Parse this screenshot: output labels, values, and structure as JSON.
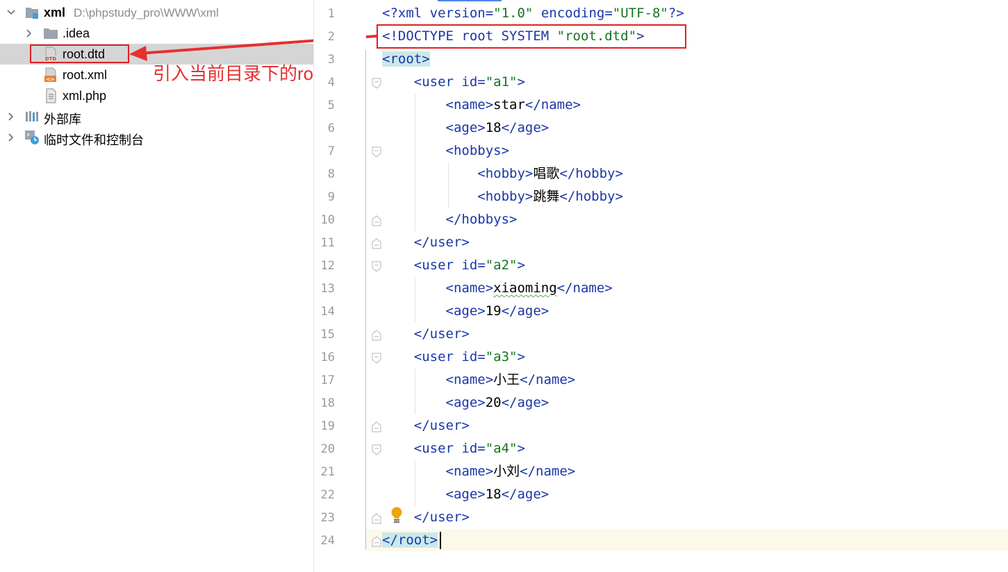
{
  "project_tree": {
    "root": {
      "name": "xml",
      "path": "D:\\phpstudy_pro\\WWW\\xml"
    },
    "items": [
      {
        "name": ".idea",
        "type": "folder",
        "expanded": false
      },
      {
        "name": "root.dtd",
        "type": "dtd-file",
        "selected": true
      },
      {
        "name": "root.xml",
        "type": "xml-file"
      },
      {
        "name": "xml.php",
        "type": "php-file"
      }
    ],
    "external_libraries": "外部库",
    "scratches": "临时文件和控制台"
  },
  "annotation": {
    "text": "引入当前目录下的root.dtd",
    "color": "#e53030"
  },
  "editor": {
    "line_numbers": [
      "1",
      "2",
      "3",
      "4",
      "5",
      "6",
      "7",
      "8",
      "9",
      "10",
      "11",
      "12",
      "13",
      "14",
      "15",
      "16",
      "17",
      "18",
      "19",
      "20",
      "21",
      "22",
      "23",
      "24"
    ],
    "l1": {
      "open": "<?",
      "kw": "xml",
      "a1": " version=",
      "v1": "\"1.0\"",
      "a2": " encoding=",
      "v2": "\"UTF-8\"",
      "close": "?>"
    },
    "l2": {
      "open": "<!DOCTYPE root SYSTEM ",
      "v": "\"root.dtd\"",
      "close": ">"
    },
    "l3": {
      "tag": "<root>"
    },
    "users": [
      {
        "open": "<user",
        "attr": " id=",
        "id": "\"a1\"",
        "gt": ">",
        "close": "</user>"
      },
      {
        "open": "<user",
        "attr": " id=",
        "id": "\"a2\"",
        "gt": ">",
        "close": "</user>"
      },
      {
        "open": "<user",
        "attr": " id=",
        "id": "\"a3\"",
        "gt": ">",
        "close": "</user>"
      },
      {
        "open": "<user",
        "attr": " id=",
        "id": "\"a4\"",
        "gt": ">",
        "close": "</user>"
      }
    ],
    "name_open": "<name>",
    "name_close": "</name>",
    "age_open": "<age>",
    "age_close": "</age>",
    "hobbys_open": "<hobbys>",
    "hobbys_close": "</hobbys>",
    "hobby_open": "<hobby>",
    "hobby_close": "</hobby>",
    "values": {
      "name1": "star",
      "age1": "18",
      "hobby1": "唱歌",
      "hobby2": "跳舞",
      "name2": "xiaoming",
      "age2": "19",
      "name3": "小王",
      "age3": "20",
      "name4": "小刘",
      "age4": "18"
    },
    "l24": {
      "lt": "</",
      "tag": "root",
      "gt": ">"
    }
  },
  "colors": {
    "tag": "#1a36a8",
    "string": "#14751e",
    "highlight_box": "#e02020",
    "current_line": "#fcf9ea"
  }
}
